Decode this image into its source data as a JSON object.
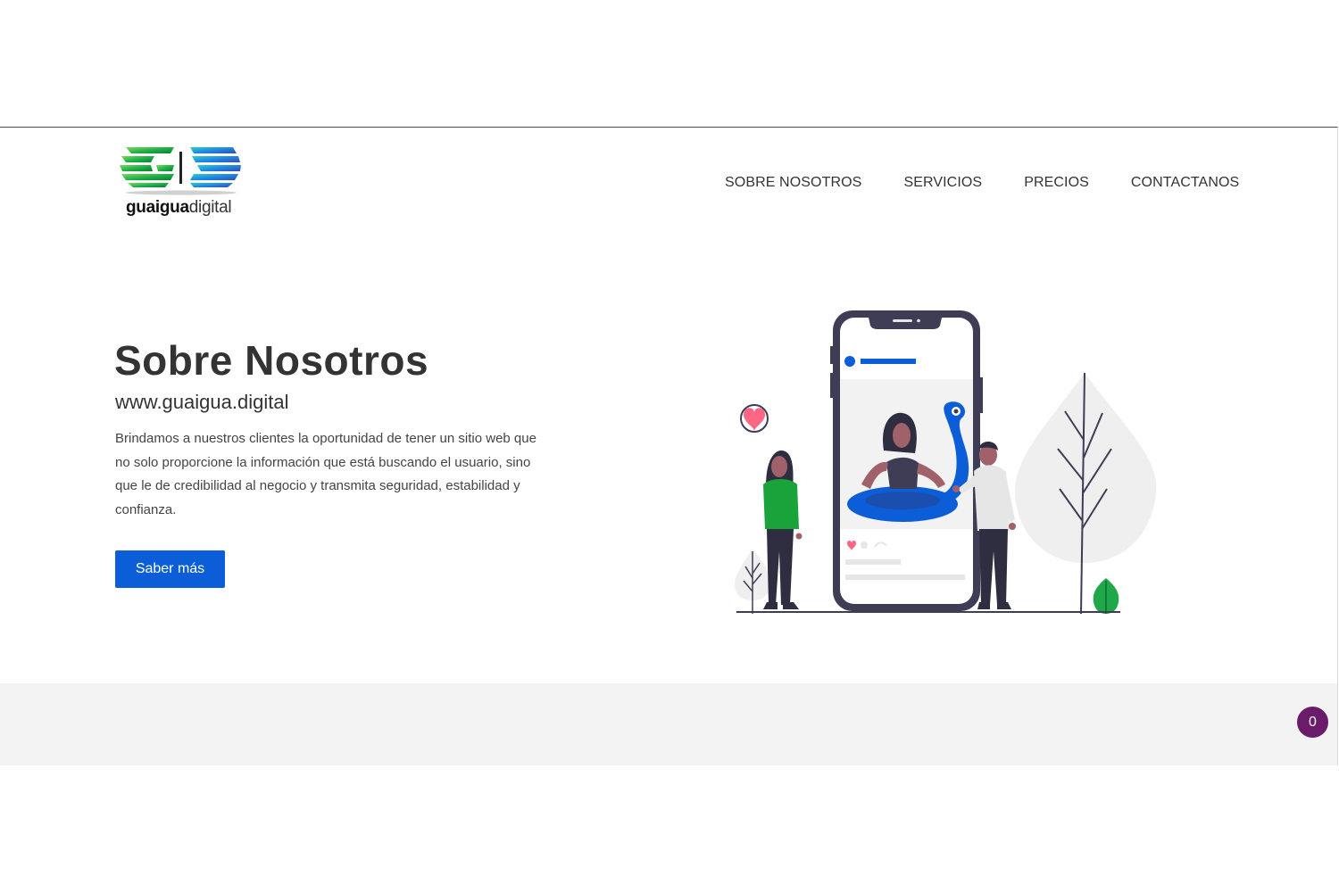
{
  "logo": {
    "text_bold": "guaigua",
    "text_light": "digital"
  },
  "nav": {
    "items": [
      {
        "label": "SOBRE NOSOTROS"
      },
      {
        "label": "SERVICIOS"
      },
      {
        "label": "PRECIOS"
      },
      {
        "label": "CONTACTANOS"
      }
    ]
  },
  "hero": {
    "title": "Sobre Nosotros",
    "url": "www.guaigua.digital",
    "description": "Brindamos a nuestros clientes la oportunidad de tener un sitio web que no solo proporcione la información que está buscando el usuario, sino que le de credibilidad al negocio y transmita seguridad, estabilidad y confianza.",
    "cta_label": "Saber más"
  },
  "badge": {
    "count": "0"
  },
  "colors": {
    "primary": "#0b5ed7",
    "badge": "#6a1b6a",
    "logo_green": "#1fb34a",
    "logo_blue": "#1e88e5"
  }
}
